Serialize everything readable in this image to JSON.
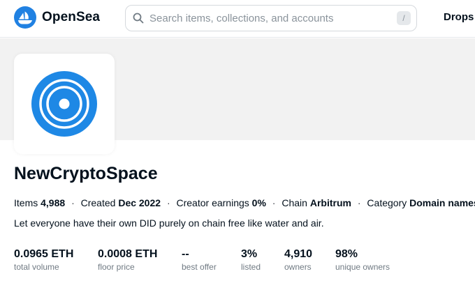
{
  "header": {
    "brand_name": "OpenSea",
    "search_placeholder": "Search items, collections, and accounts",
    "search_shortcut": "/",
    "nav_drops": "Drops",
    "accent_color": "#2081e2"
  },
  "collection": {
    "name": "NewCryptoSpace",
    "meta": {
      "items_label": "Items",
      "items_value": "4,988",
      "created_label": "Created",
      "created_value": "Dec 2022",
      "creator_earnings_label": "Creator earnings",
      "creator_earnings_value": "0%",
      "chain_label": "Chain",
      "chain_value": "Arbitrum",
      "category_label": "Category",
      "category_value": "Domain names",
      "separator": "·"
    },
    "description": "Let everyone have their own DID purely on chain free like water and air.",
    "stats": [
      {
        "value": "0.0965 ETH",
        "label": "total volume"
      },
      {
        "value": "0.0008 ETH",
        "label": "floor price"
      },
      {
        "value": "--",
        "label": "best offer"
      },
      {
        "value": "3%",
        "label": "listed"
      },
      {
        "value": "4,910",
        "label": "owners"
      },
      {
        "value": "98%",
        "label": "unique owners"
      }
    ]
  }
}
